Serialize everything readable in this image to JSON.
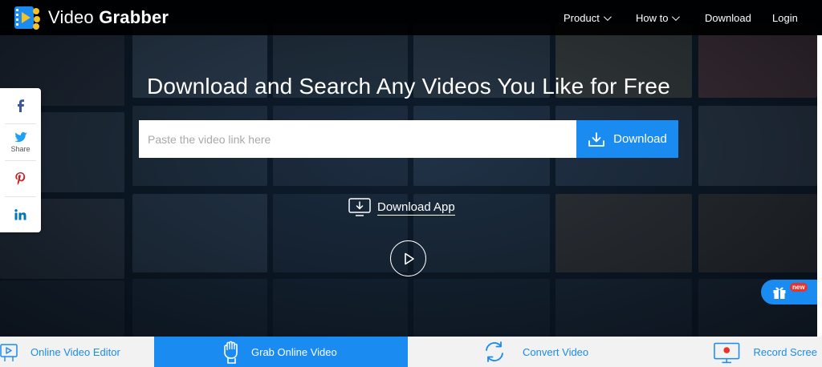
{
  "header": {
    "brand_light": "Video",
    "brand_bold": "Grabber",
    "nav": [
      {
        "label": "Product",
        "has_dropdown": true
      },
      {
        "label": "How to",
        "has_dropdown": true
      },
      {
        "label": "Download",
        "has_dropdown": false
      },
      {
        "label": "Login",
        "has_dropdown": false
      }
    ]
  },
  "hero": {
    "headline": "Download and Search Any Videos You Like for Free",
    "search": {
      "placeholder": "Paste the video link here",
      "value": "",
      "button_label": "Download"
    },
    "download_app_label": "Download App"
  },
  "share": {
    "items": [
      {
        "icon": "facebook-icon",
        "label": ""
      },
      {
        "icon": "twitter-icon",
        "label": "Share"
      },
      {
        "icon": "pinterest-icon",
        "label": ""
      },
      {
        "icon": "linkedin-icon",
        "label": ""
      }
    ]
  },
  "gift": {
    "badge": "new",
    "icon": "gift-icon"
  },
  "features": [
    {
      "label": "Online Video Editor",
      "icon": "video-editor-icon",
      "active": false
    },
    {
      "label": "Grab Online Video",
      "icon": "fist-icon",
      "active": true
    },
    {
      "label": "Convert Video",
      "icon": "convert-icon",
      "active": false
    },
    {
      "label": "Record Scree",
      "icon": "record-screen-icon",
      "active": false
    }
  ],
  "colors": {
    "accent": "#1a8bf0",
    "header_bg": "#000000",
    "feature_bar_bg": "#f2f2f2",
    "badge": "#e8332a"
  }
}
